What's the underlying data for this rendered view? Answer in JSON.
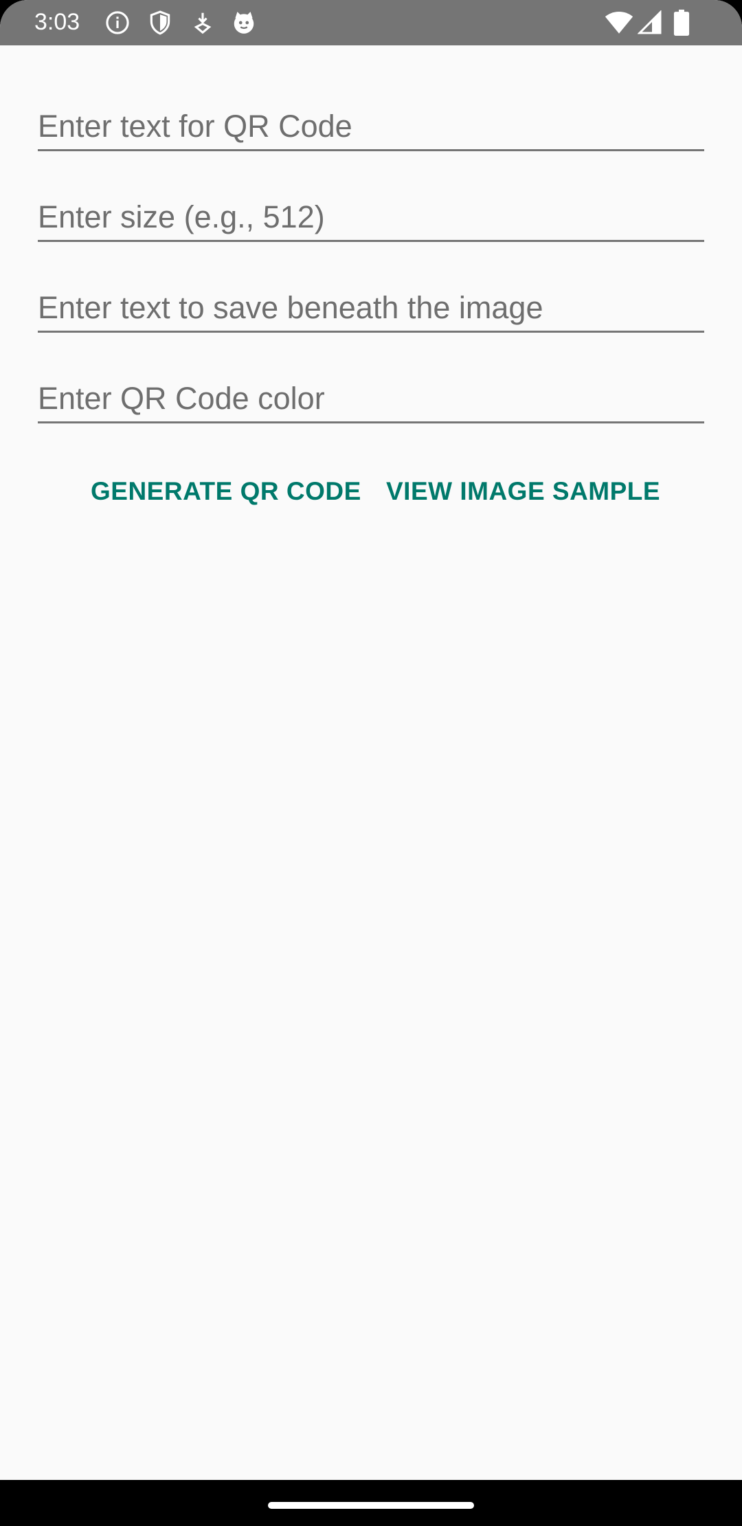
{
  "status_bar": {
    "time": "3:03",
    "left_icons": [
      "info-icon",
      "shield-icon",
      "download-icon",
      "cat-icon"
    ],
    "right_icons": [
      "wifi-icon",
      "cell-signal-icon",
      "battery-icon"
    ]
  },
  "form": {
    "qr_text_placeholder": "Enter text for QR Code",
    "size_placeholder": "Enter size (e.g., 512)",
    "caption_placeholder": "Enter text to save beneath the image",
    "color_placeholder": "Enter QR Code color"
  },
  "actions": {
    "generate_label": "GENERATE QR CODE",
    "view_sample_label": "VIEW IMAGE SAMPLE"
  },
  "colors": {
    "accent": "#00796b",
    "status_bar": "#757575",
    "background": "#fafafa",
    "underline": "#757575"
  }
}
